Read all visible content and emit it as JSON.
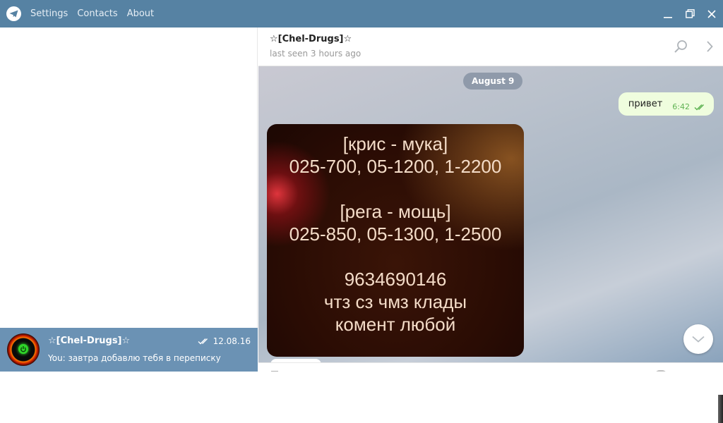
{
  "titlebar": {
    "menu": [
      "Settings",
      "Contacts",
      "About"
    ]
  },
  "sidebar": {
    "dialog": {
      "name": "☆[Chel-Drugs]☆",
      "date": "12.08.16",
      "preview": "You: завтра добавлю тебя в переписку"
    }
  },
  "chat": {
    "peer_name": "☆[Chel-Drugs]☆",
    "peer_status": "last seen 3 hours ago",
    "date_label": "August 9",
    "outgoing": {
      "text": "привет",
      "time": "6:42"
    },
    "photo_lines": [
      "[крис - мука]",
      "025-700, 05-1200, 1-2200",
      "",
      "[рега - мощь]",
      "025-850, 05-1300, 1-2500",
      "",
      "9634690146",
      "чтз сз чмз клады",
      "комент любой"
    ]
  },
  "icons": {
    "logo": "telegram-logo",
    "search": "search-icon",
    "forward": "chevron-right-icon",
    "scroll_down": "chevron-down-icon",
    "read_receipt": "double-check-icon"
  },
  "colors": {
    "titlebar": "#5682a3",
    "active_dialog": "#6b92b4",
    "outgoing_bubble": "#effdde",
    "outgoing_meta": "#5fb353"
  }
}
